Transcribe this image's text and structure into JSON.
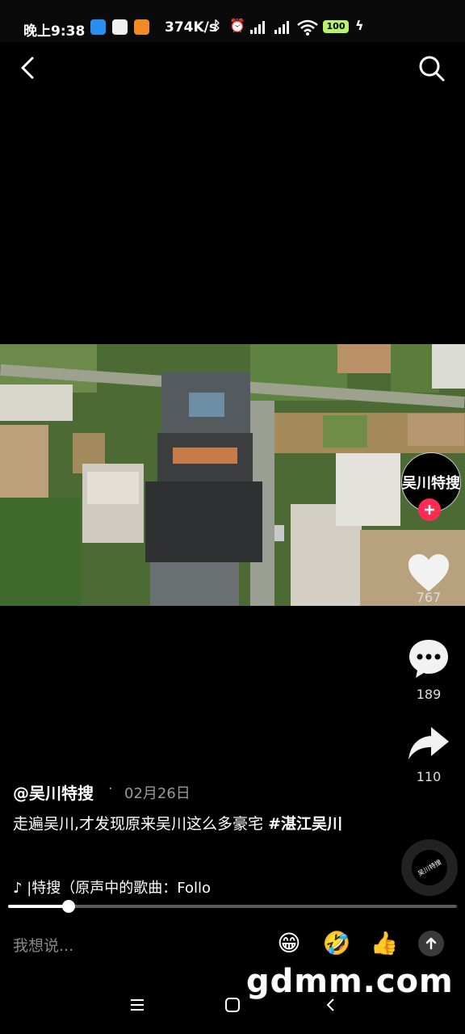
{
  "status_bar": {
    "time": "晚上9:38",
    "network_speed": "374K/s",
    "battery": "100"
  },
  "video": {
    "author_avatar_text": "吴川特搜",
    "like_count": "767",
    "comment_count": "189",
    "share_count": "110",
    "author": "@吴川特搜",
    "separator": "·",
    "date": "02月26日",
    "caption": "走遍吴川,才发现原来吴川这么多豪宅 ",
    "hashtag": "#湛江吴川",
    "music": "|特搜（原声中的歌曲：Follo",
    "disc_text": "吴川特搜",
    "progress": 0.135
  },
  "comment": {
    "placeholder": "我想说..."
  },
  "emojis": [
    "grin-emoji",
    "laugh-cry-emoji",
    "thumbs-up-emoji"
  ],
  "watermark": "gdmm.com",
  "colors": {
    "accent": "#fe2c55",
    "battery": "#b6f56a"
  }
}
